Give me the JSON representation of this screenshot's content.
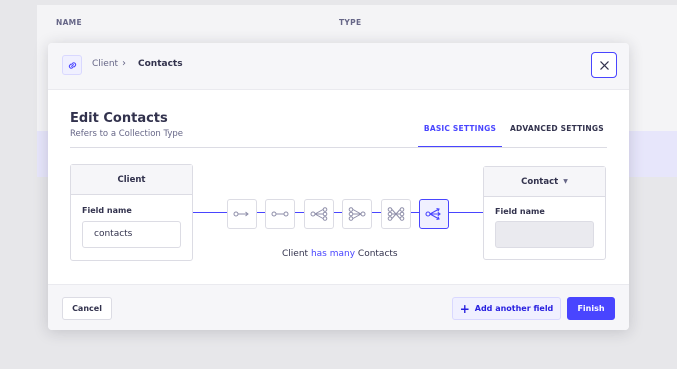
{
  "background": {
    "columns": [
      "NAME",
      "TYPE"
    ]
  },
  "modal": {
    "breadcrumb": {
      "parent": "Client",
      "separator": "›",
      "current": "Contacts"
    },
    "title": "Edit Contacts",
    "subtitle": "Refers to a Collection Type",
    "tabs": [
      {
        "label": "BASIC SETTINGS",
        "active": true
      },
      {
        "label": "ADVANCED SETTINGS",
        "active": false
      }
    ],
    "left": {
      "header": "Client",
      "field_label": "Field name",
      "field_value": "contacts"
    },
    "right": {
      "header": "Contact",
      "field_label": "Field name",
      "field_value": ""
    },
    "relation_types": [
      {
        "icon": "one-way-icon"
      },
      {
        "icon": "one-to-one-icon"
      },
      {
        "icon": "one-to-many-icon"
      },
      {
        "icon": "many-to-one-icon"
      },
      {
        "icon": "many-to-many-icon"
      },
      {
        "icon": "many-ways-icon",
        "active": true
      }
    ],
    "relation_text": {
      "left": "Client",
      "middle": "has many",
      "right": "Contacts"
    },
    "footer": {
      "cancel": "Cancel",
      "add_another": "Add another field",
      "finish": "Finish"
    }
  },
  "colors": {
    "primary": "#4945ff",
    "text": "#32324d",
    "muted": "#666687"
  }
}
